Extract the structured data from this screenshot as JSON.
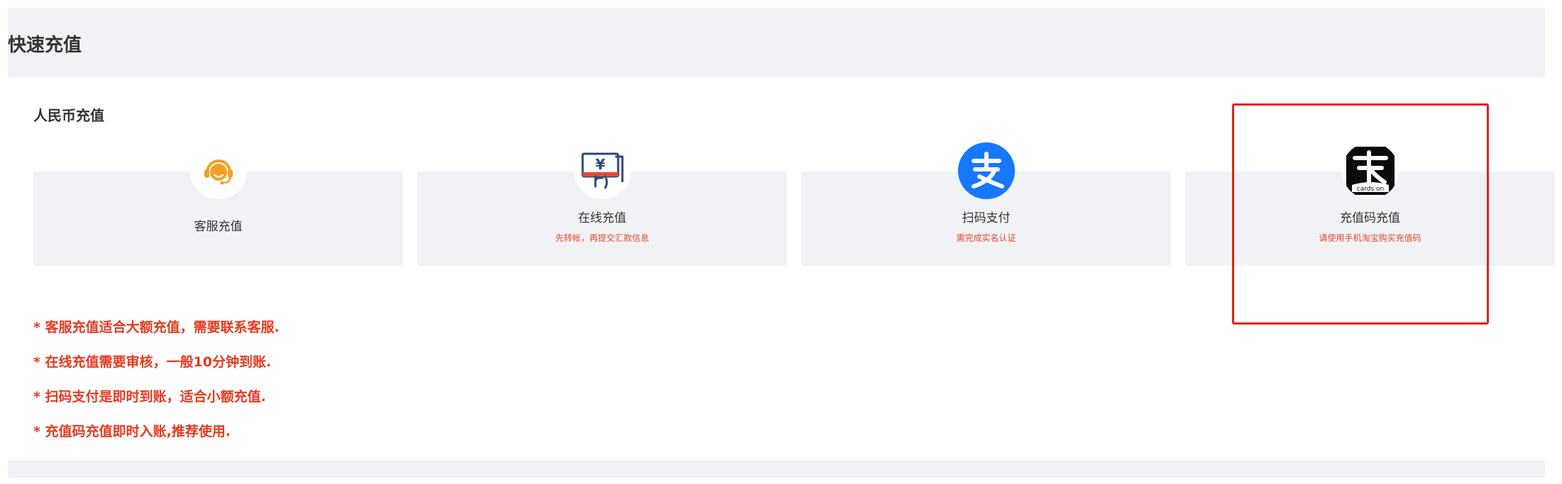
{
  "page": {
    "title": "快速充值"
  },
  "section": {
    "title": "人民币充值"
  },
  "cards": [
    {
      "label": "客服充值",
      "subtitle": "",
      "icon": "headset-icon"
    },
    {
      "label": "在线充值",
      "subtitle": "先转帐，再提交汇款信息",
      "icon": "bank-transfer-icon"
    },
    {
      "label": "扫码支付",
      "subtitle": "需完成实名认证",
      "icon": "alipay-icon"
    },
    {
      "label": "充值码充值",
      "subtitle": "请使用手机淘宝购买充值码",
      "icon": "cards-on-icon",
      "icon_text": "cards on"
    }
  ],
  "notes": [
    "* 客服充值适合大额充值，需要联系客服.",
    "* 在线充值需要审核，一般10分钟到账.",
    "* 扫码支付是即时到账，适合小额充值.",
    "* 充值码充值即时入账,推荐使用."
  ],
  "colors": {
    "accent_red": "#e8391f",
    "highlight_border": "#e81e1e",
    "alipay_blue": "#1677ff",
    "headset_orange": "#f5a023",
    "card_bg": "#f1f2f6"
  }
}
